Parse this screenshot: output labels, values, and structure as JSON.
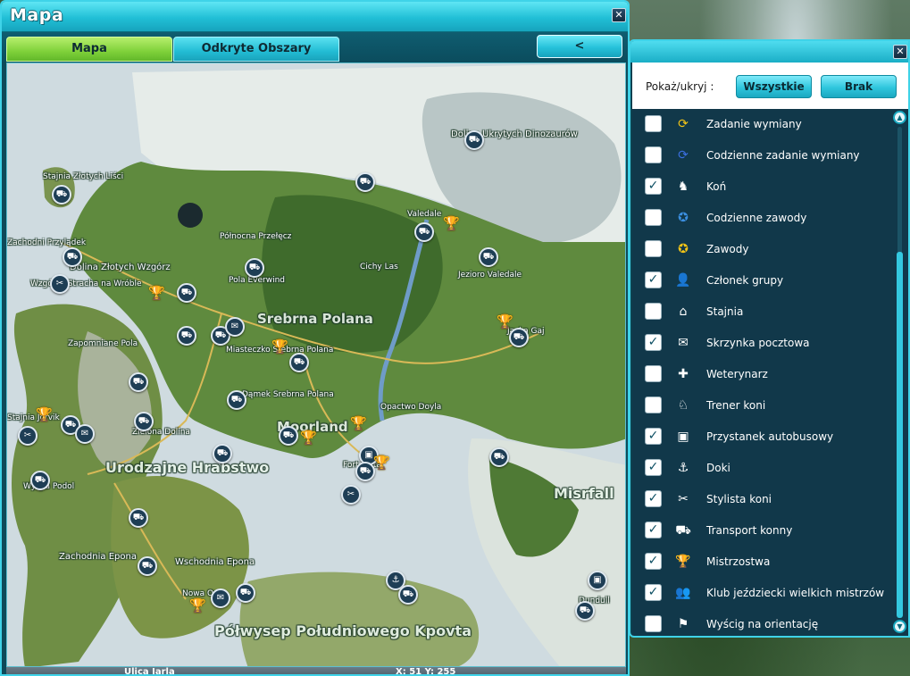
{
  "window": {
    "title": "Mapa",
    "close_glyph": "✕",
    "back_label": "<"
  },
  "tabs": [
    {
      "label": "Mapa",
      "active": true
    },
    {
      "label": "Odkryte Obszary",
      "active": false
    }
  ],
  "map": {
    "regions": [
      {
        "label": "Dolina Ukrytych Dinozaurów"
      },
      {
        "label": "Stajnia Złotych Liści"
      },
      {
        "label": "Zachodni Przylądek"
      },
      {
        "label": "Dolina Złotych Wzgórz"
      },
      {
        "label": "Wzgórze Stracha na Wróble"
      },
      {
        "label": "Północna Przełęcz"
      },
      {
        "label": "Valedale"
      },
      {
        "label": "Cichy Las"
      },
      {
        "label": "Jezioro Valedale"
      },
      {
        "label": "Pola Everwind"
      },
      {
        "label": "Srebrna Polana"
      },
      {
        "label": "Zapomniane Pola"
      },
      {
        "label": "Miasteczko Srebrna Polana"
      },
      {
        "label": "Jacka Gaj"
      },
      {
        "label": "Dąmek Srebrna Polana"
      },
      {
        "label": "Opactwo Doyla"
      },
      {
        "label": "Moorland"
      },
      {
        "label": "Stajnia Jorvik"
      },
      {
        "label": "Zielona Dolina"
      },
      {
        "label": "Urodzajne Hrabstwo"
      },
      {
        "label": "Fort Pinta"
      },
      {
        "label": "Wyspa Podol"
      },
      {
        "label": "Misrfall"
      },
      {
        "label": "Zachodnia Epona"
      },
      {
        "label": "Wschodnia Epona"
      },
      {
        "label": "Nowa Ona"
      },
      {
        "label": "Półwysep Południowego Kpovta"
      },
      {
        "label": "Dundull"
      }
    ]
  },
  "status": {
    "street": "Ulica Jarla",
    "coords": "X: 51 Y: 255"
  },
  "legend": {
    "close_glyph": "✕",
    "filter_label": "Pokaż/ukryj :",
    "btn_all": "Wszystkie",
    "btn_none": "Brak",
    "check_glyph": "✓",
    "items": [
      {
        "label": "Zadanie wymiany",
        "checked": false,
        "icon": "exchange-quest-icon",
        "glyph": "⟳",
        "color": "#f2c417"
      },
      {
        "label": "Codzienne zadanie wymiany",
        "checked": false,
        "icon": "daily-exchange-quest-icon",
        "glyph": "⟳",
        "color": "#3b6fe0"
      },
      {
        "label": "Koń",
        "checked": true,
        "icon": "horse-icon",
        "glyph": "♞",
        "color": "#ffffff"
      },
      {
        "label": "Codzienne zawody",
        "checked": false,
        "icon": "daily-competition-icon",
        "glyph": "✪",
        "color": "#3b8fe0"
      },
      {
        "label": "Zawody",
        "checked": false,
        "icon": "competition-icon",
        "glyph": "✪",
        "color": "#f2c417"
      },
      {
        "label": "Członek grupy",
        "checked": true,
        "icon": "group-member-icon",
        "glyph": "👤",
        "color": "#5ad0e8"
      },
      {
        "label": "Stajnia",
        "checked": false,
        "icon": "stable-icon",
        "glyph": "⌂",
        "color": "#ffffff"
      },
      {
        "label": "Skrzynka pocztowa",
        "checked": true,
        "icon": "mailbox-icon",
        "glyph": "✉",
        "color": "#ffffff"
      },
      {
        "label": "Weterynarz",
        "checked": false,
        "icon": "vet-icon",
        "glyph": "✚",
        "color": "#ffffff"
      },
      {
        "label": "Trener koni",
        "checked": false,
        "icon": "horse-trainer-icon",
        "glyph": "♘",
        "color": "#ffffff"
      },
      {
        "label": "Przystanek autobusowy",
        "checked": true,
        "icon": "bus-stop-icon",
        "glyph": "▣",
        "color": "#ffffff"
      },
      {
        "label": "Doki",
        "checked": true,
        "icon": "anchor-icon",
        "glyph": "⚓",
        "color": "#ffffff"
      },
      {
        "label": "Stylista koni",
        "checked": true,
        "icon": "horse-stylist-icon",
        "glyph": "✂",
        "color": "#ffffff"
      },
      {
        "label": "Transport konny",
        "checked": true,
        "icon": "horse-transport-icon",
        "glyph": "⛟",
        "color": "#ffffff"
      },
      {
        "label": "Mistrzostwa",
        "checked": true,
        "icon": "trophy-icon",
        "glyph": "🏆",
        "color": "#f2c417"
      },
      {
        "label": "Klub jeździecki wielkich mistrzów",
        "checked": true,
        "icon": "club-icon",
        "glyph": "👥",
        "color": "#ffffff"
      },
      {
        "label": "Wyścig na orientację",
        "checked": false,
        "icon": "orienteering-icon",
        "glyph": "⚑",
        "color": "#ffffff"
      }
    ]
  }
}
